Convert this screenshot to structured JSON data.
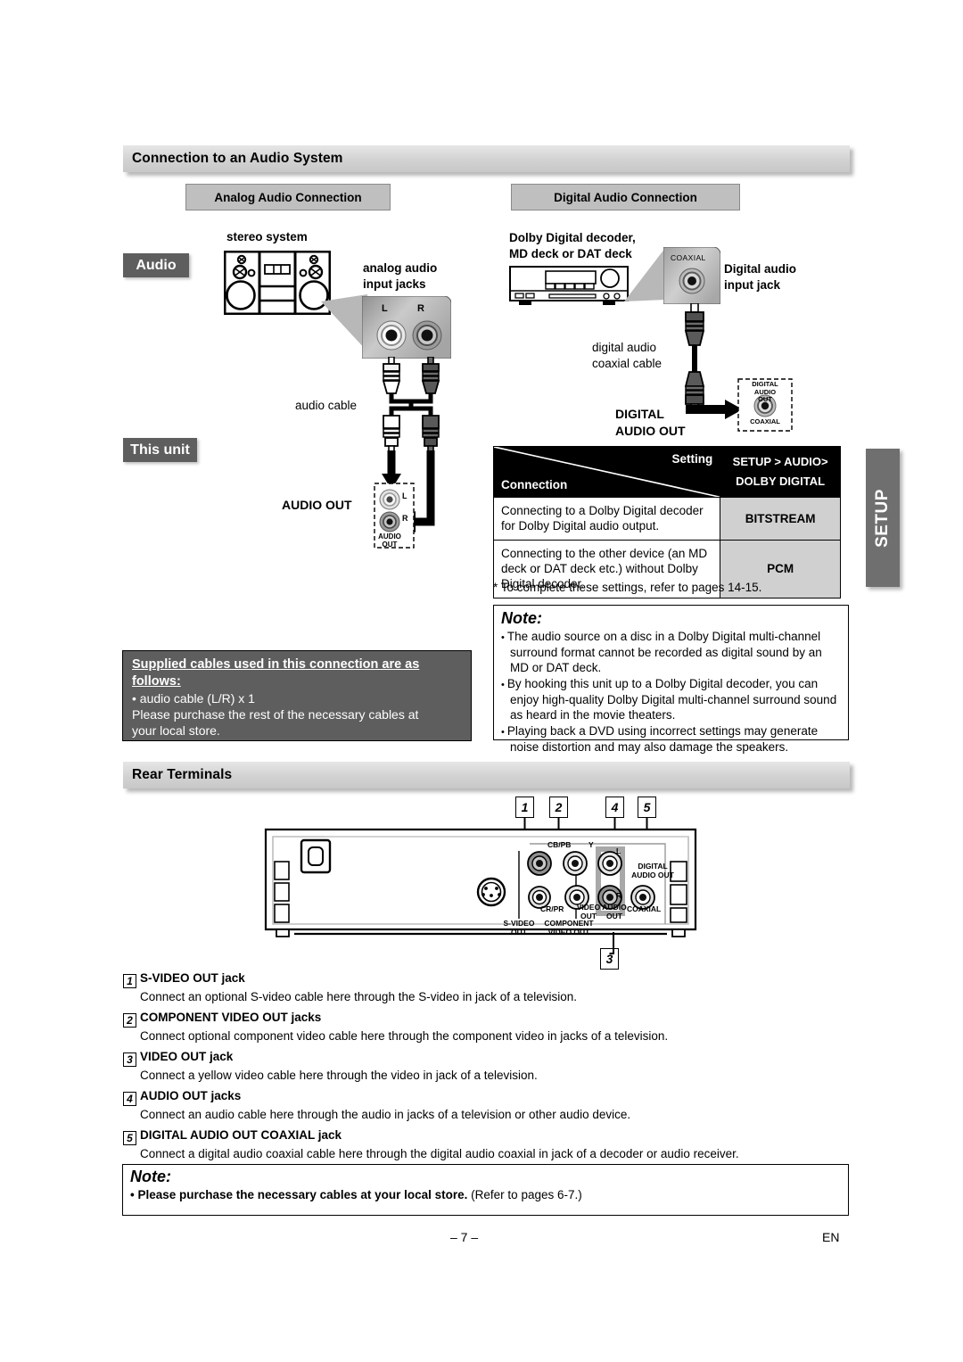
{
  "sections": {
    "audio_system": "Connection to an Audio System",
    "rear_terminals": "Rear Terminals"
  },
  "subheads": {
    "analog": "Analog Audio Connection",
    "digital": "Digital Audio Connection"
  },
  "tags": {
    "audio": "Audio",
    "this_unit": "This unit"
  },
  "side_tab": {
    "label": "SETUP"
  },
  "analog_diagram": {
    "device_label": "stereo system",
    "jacks_label_line1": "analog audio",
    "jacks_label_line2": "input jacks",
    "jack_l": "L",
    "jack_r": "R",
    "cable_label": "audio cable",
    "audio_out_label": "AUDIO OUT",
    "unit_jack_l": "L",
    "unit_jack_r": "R",
    "unit_jack_caption_line1": "AUDIO",
    "unit_jack_caption_line2": "OUT"
  },
  "digital_diagram": {
    "device_label_line1": "Dolby Digital decoder,",
    "device_label_line2": "MD deck or DAT deck",
    "coaxial_label": "COAXIAL",
    "input_jack_line1": "Digital audio",
    "input_jack_line2": "input jack",
    "cable_label_line1": "digital audio",
    "cable_label_line2": "coaxial cable",
    "out_label_line1": "DIGITAL",
    "out_label_line2": "AUDIO OUT",
    "unit_jack_caption_line1": "DIGITAL",
    "unit_jack_caption_line2": "AUDIO OUT",
    "unit_jack_caption_line3": "COAXIAL"
  },
  "settings_table": {
    "header_setting": "Setting",
    "header_connection": "Connection",
    "header_path_line1": "SETUP > AUDIO>",
    "header_path_line2": "DOLBY DIGITAL",
    "rows": [
      {
        "connection": "Connecting to a Dolby Digital decoder for Dolby Digital audio output.",
        "setting": "BITSTREAM"
      },
      {
        "connection": "Connecting to the other device (an MD deck or DAT deck etc.) without Dolby Digital decoder.",
        "setting": "PCM"
      }
    ],
    "footnote": "* To complete these settings, refer to pages 14-15."
  },
  "note_top": {
    "title": "Note:",
    "items": [
      "The audio source on a disc in a Dolby Digital multi-channel surround format cannot be recorded as digital sound by an MD or DAT deck.",
      "By hooking this unit up to a Dolby Digital decoder, you can enjoy high-quality Dolby Digital multi-channel surround sound as heard in the movie theaters.",
      "Playing back a DVD using incorrect settings may generate noise distortion and may also damage the speakers."
    ]
  },
  "supplied_cables": {
    "heading_line1": "Supplied cables used in this connection are as",
    "heading_line2": "follows:",
    "bullet": "• audio cable (L/R) x 1",
    "body_line1": "Please purchase the rest of the necessary cables at",
    "body_line2": "your local store."
  },
  "rear_panel": {
    "callouts": [
      "1",
      "2",
      "4",
      "5",
      "3"
    ],
    "labels": {
      "s_video_line1": "S-VIDEO",
      "s_video_line2": "OUT",
      "component_line1": "COMPONENT",
      "component_line2": "VIDEO OUT",
      "cb_pb_top": "CB/PB",
      "y": "Y",
      "cr_pr": "CR/PR",
      "video_out_line1": "VIDEO",
      "video_out_line2": "OUT",
      "audio_out_line1": "AUDIO",
      "audio_out_line2": "OUT",
      "audio_l": "L",
      "audio_r": "R",
      "digital_line1": "DIGITAL",
      "digital_line2": "AUDIO OUT",
      "coaxial": "COAXIAL"
    }
  },
  "terminal_list": [
    {
      "num": "1",
      "title": "S-VIDEO OUT jack",
      "desc": "Connect an optional S-video cable here through the S-video in jack of a television."
    },
    {
      "num": "2",
      "title": "COMPONENT VIDEO OUT jacks",
      "desc": "Connect optional component video cable here through the component video in jacks of a television."
    },
    {
      "num": "3",
      "title": "VIDEO OUT jack",
      "desc": "Connect a yellow video cable here through the video in jack of a television."
    },
    {
      "num": "4",
      "title": "AUDIO OUT jacks",
      "desc": "Connect an audio cable here through the audio in jacks of a television or other audio device."
    },
    {
      "num": "5",
      "title": "DIGITAL AUDIO OUT COAXIAL jack",
      "desc": "Connect a digital audio coaxial cable here through the digital audio coaxial in jack of a decoder or audio receiver."
    }
  ],
  "note_bottom": {
    "title": "Note:",
    "bullet_bold": "• Please purchase the necessary cables at your local store.",
    "bullet_rest": " (Refer to pages 6-7.)"
  },
  "footer": {
    "page_number": "– 7 –",
    "lang": "EN"
  },
  "colors": {
    "bar_gray": "#d2d2d2",
    "tag_gray": "#5e5e5e",
    "subhead_gray": "#bfbfbf",
    "table_fill": "#d0d0d0"
  }
}
